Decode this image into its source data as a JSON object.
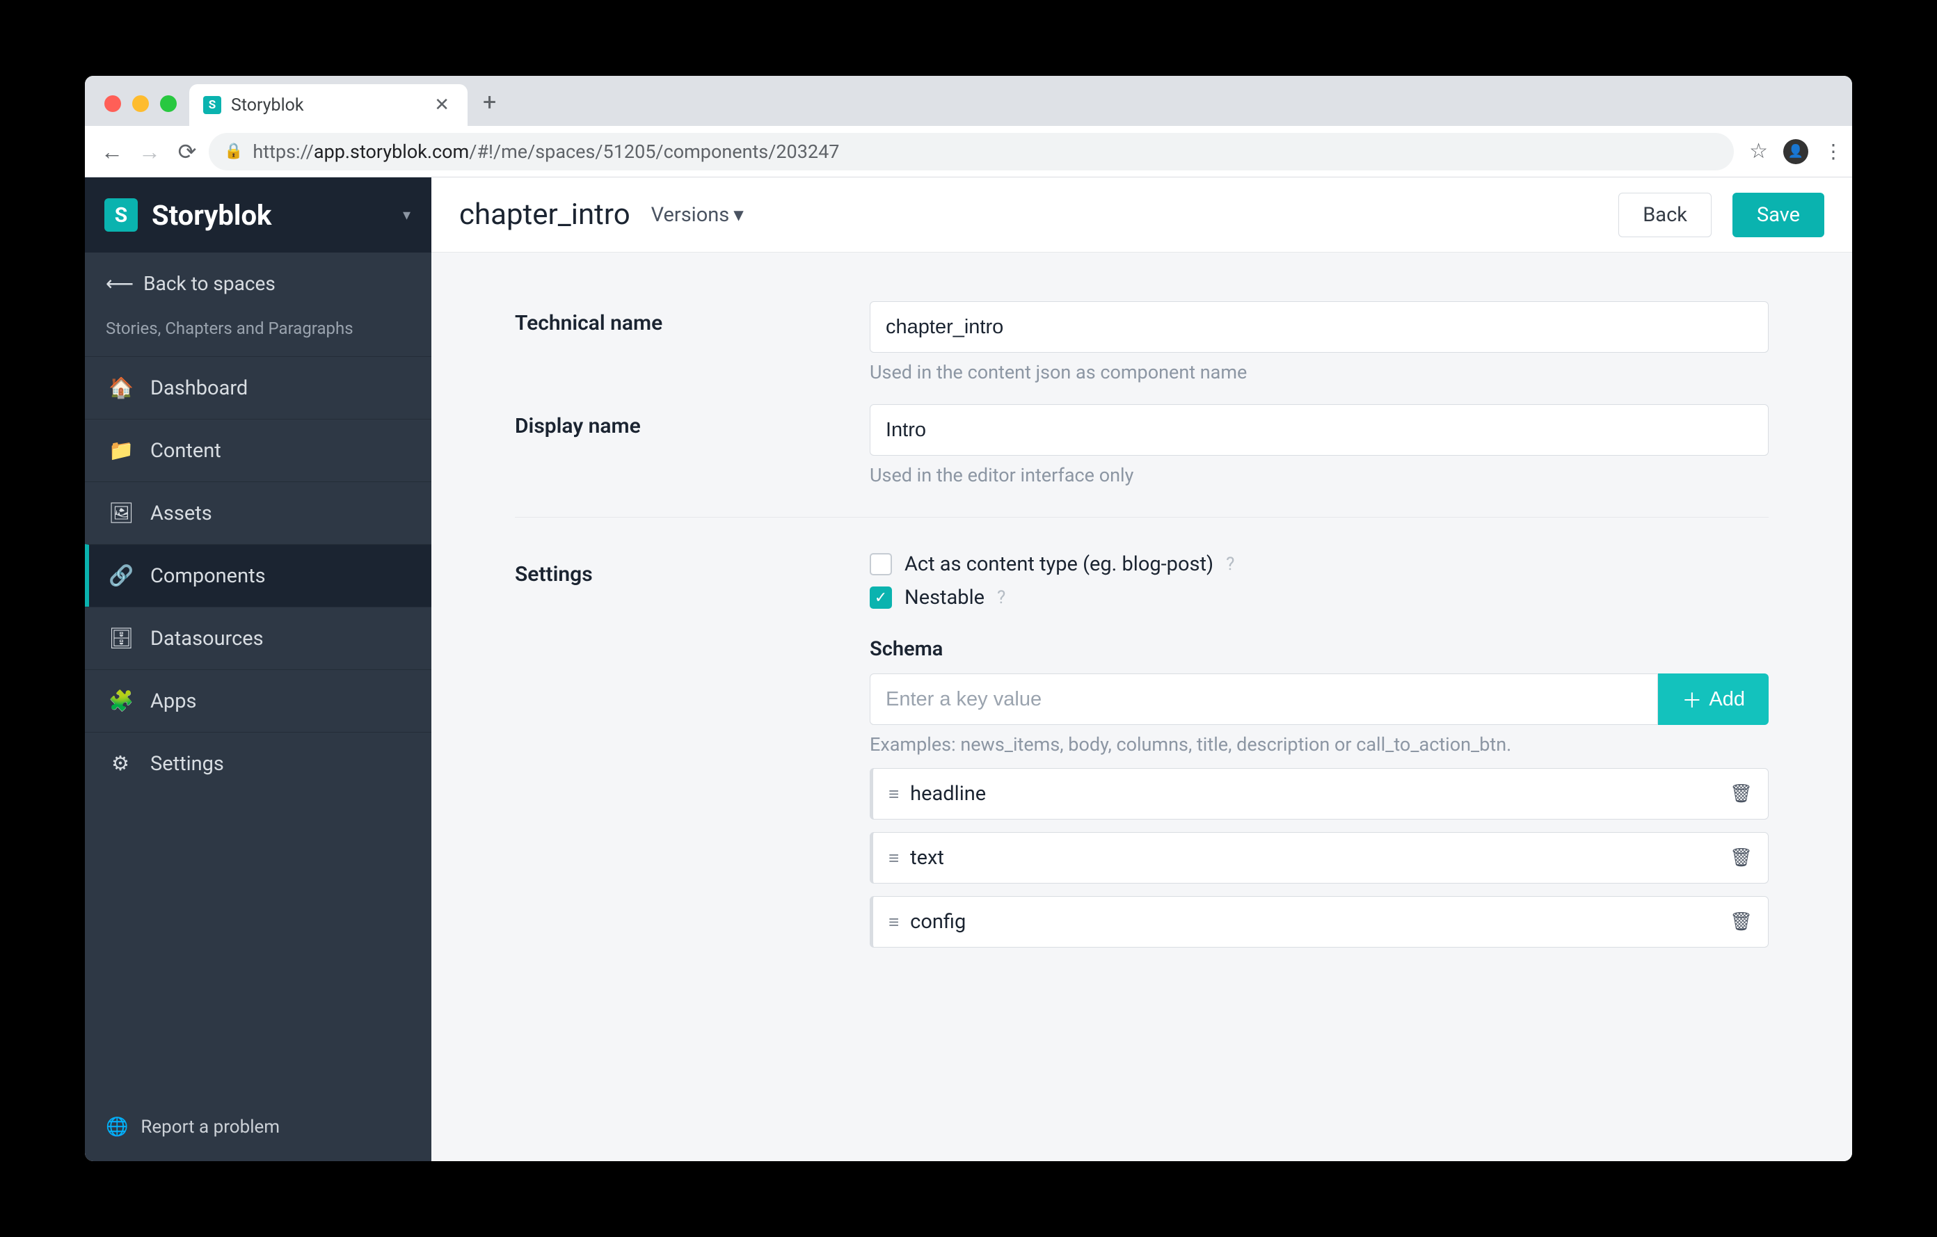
{
  "browser": {
    "tab_title": "Storyblok",
    "url_prefix": "https://",
    "url_host": "app.storyblok.com",
    "url_path": "/#!/me/spaces/51205/components/203247"
  },
  "sidebar": {
    "brand": "Storyblok",
    "back_label": "Back to spaces",
    "space_name": "Stories, Chapters and Paragraphs",
    "items": [
      {
        "icon": "🏠",
        "label": "Dashboard"
      },
      {
        "icon": "📁",
        "label": "Content"
      },
      {
        "icon": "🖼",
        "label": "Assets"
      },
      {
        "icon": "🔗",
        "label": "Components"
      },
      {
        "icon": "🗄",
        "label": "Datasources"
      },
      {
        "icon": "🧩",
        "label": "Apps"
      },
      {
        "icon": "⚙",
        "label": "Settings"
      }
    ],
    "footer": "Report a problem"
  },
  "topbar": {
    "title": "chapter_intro",
    "versions_label": "Versions",
    "back": "Back",
    "save": "Save"
  },
  "form": {
    "tech_label": "Technical name",
    "tech_value": "chapter_intro",
    "tech_help": "Used in the content json as component name",
    "display_label": "Display name",
    "display_value": "Intro",
    "display_help": "Used in the editor interface only",
    "settings_label": "Settings",
    "cb_content_type": "Act as content type (eg. blog-post)",
    "cb_nestable": "Nestable",
    "schema_label": "Schema",
    "schema_placeholder": "Enter a key value",
    "add_label": "Add",
    "schema_help": "Examples: news_items, body, columns, title, description or call_to_action_btn.",
    "fields": [
      {
        "name": "headline"
      },
      {
        "name": "text"
      },
      {
        "name": "config"
      }
    ]
  }
}
